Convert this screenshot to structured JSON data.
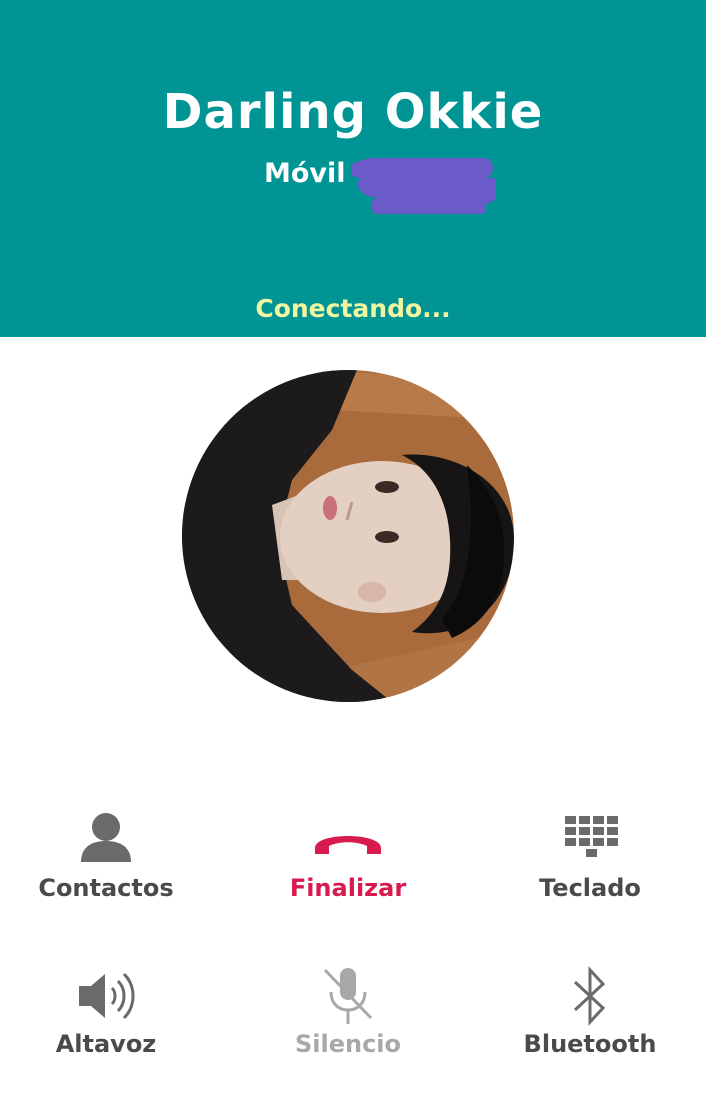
{
  "call": {
    "contact_name": "Darling Okkie",
    "phone_type": "Móvil",
    "status": "Conectando..."
  },
  "colors": {
    "header_bg": "#009494",
    "status_text": "#f2f5a0",
    "end_call": "#d81b4f",
    "icon_gray": "#6a6a6a",
    "disabled_gray": "#a8a8a8",
    "redaction": "#6b5bc8"
  },
  "controls": {
    "contacts": {
      "label": "Contactos",
      "icon": "person-icon"
    },
    "end": {
      "label": "Finalizar",
      "icon": "phone-hangup-icon"
    },
    "keypad": {
      "label": "Teclado",
      "icon": "dialpad-icon"
    },
    "speaker": {
      "label": "Altavoz",
      "icon": "speaker-icon"
    },
    "mute": {
      "label": "Silencio",
      "icon": "mic-off-icon",
      "disabled": true
    },
    "bluetooth": {
      "label": "Bluetooth",
      "icon": "bluetooth-icon"
    }
  }
}
